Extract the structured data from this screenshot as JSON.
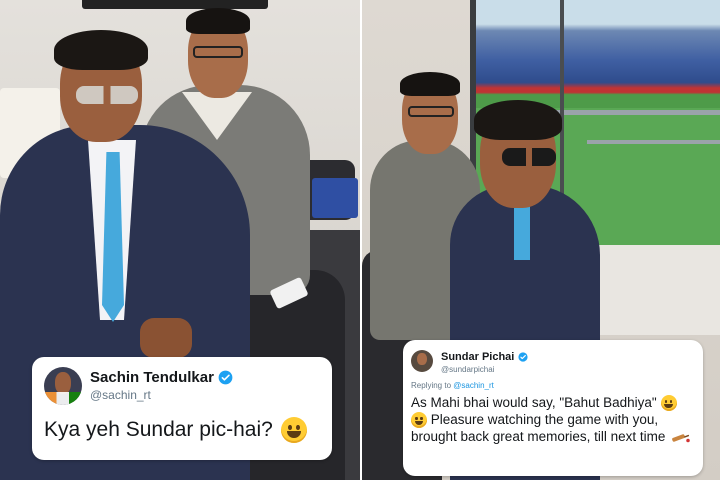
{
  "tweets": {
    "sachin": {
      "display_name": "Sachin Tendulkar",
      "handle": "@sachin_rt",
      "text": "Kya yeh Sundar pic-hai?",
      "emoji": "grinning-face-emoji"
    },
    "sundar": {
      "display_name": "Sundar Pichai",
      "handle": "@sundarpichai",
      "replying_prefix": "Replying to",
      "replying_to": "@sachin_rt",
      "text_part1": "As Mahi bhai would say, \"Bahut Badhiya\"",
      "text_part2": "Pleasure watching the game with you, brought back great memories, till next time",
      "emojis": [
        "grinning-face-emoji",
        "grinning-face-emoji",
        "cricket-bat-emoji"
      ]
    }
  },
  "colors": {
    "verified_blue": "#1da1f2",
    "mention_blue": "#1b95e0",
    "text_primary": "#14171a",
    "text_secondary": "#657786"
  }
}
